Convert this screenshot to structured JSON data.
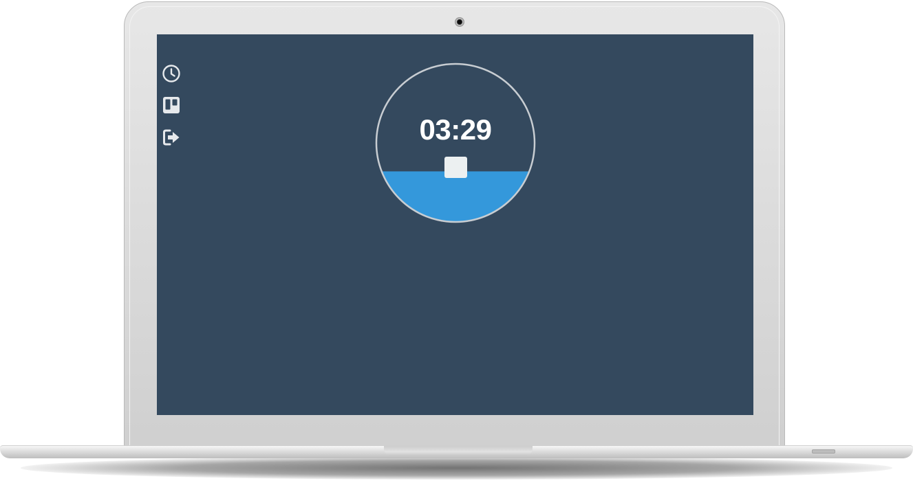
{
  "timer": {
    "display": "03:29",
    "progress_fraction": 0.32
  },
  "sidebar": {
    "items": [
      {
        "icon": "clock-icon"
      },
      {
        "icon": "board-icon"
      },
      {
        "icon": "logout-icon"
      }
    ]
  },
  "colors": {
    "background": "#34495e",
    "progress_fill": "#3498db",
    "ring": "#c8cdd2",
    "text": "#ffffff",
    "stop_button": "#ecf0f1",
    "icons": "#e6e9ec"
  }
}
